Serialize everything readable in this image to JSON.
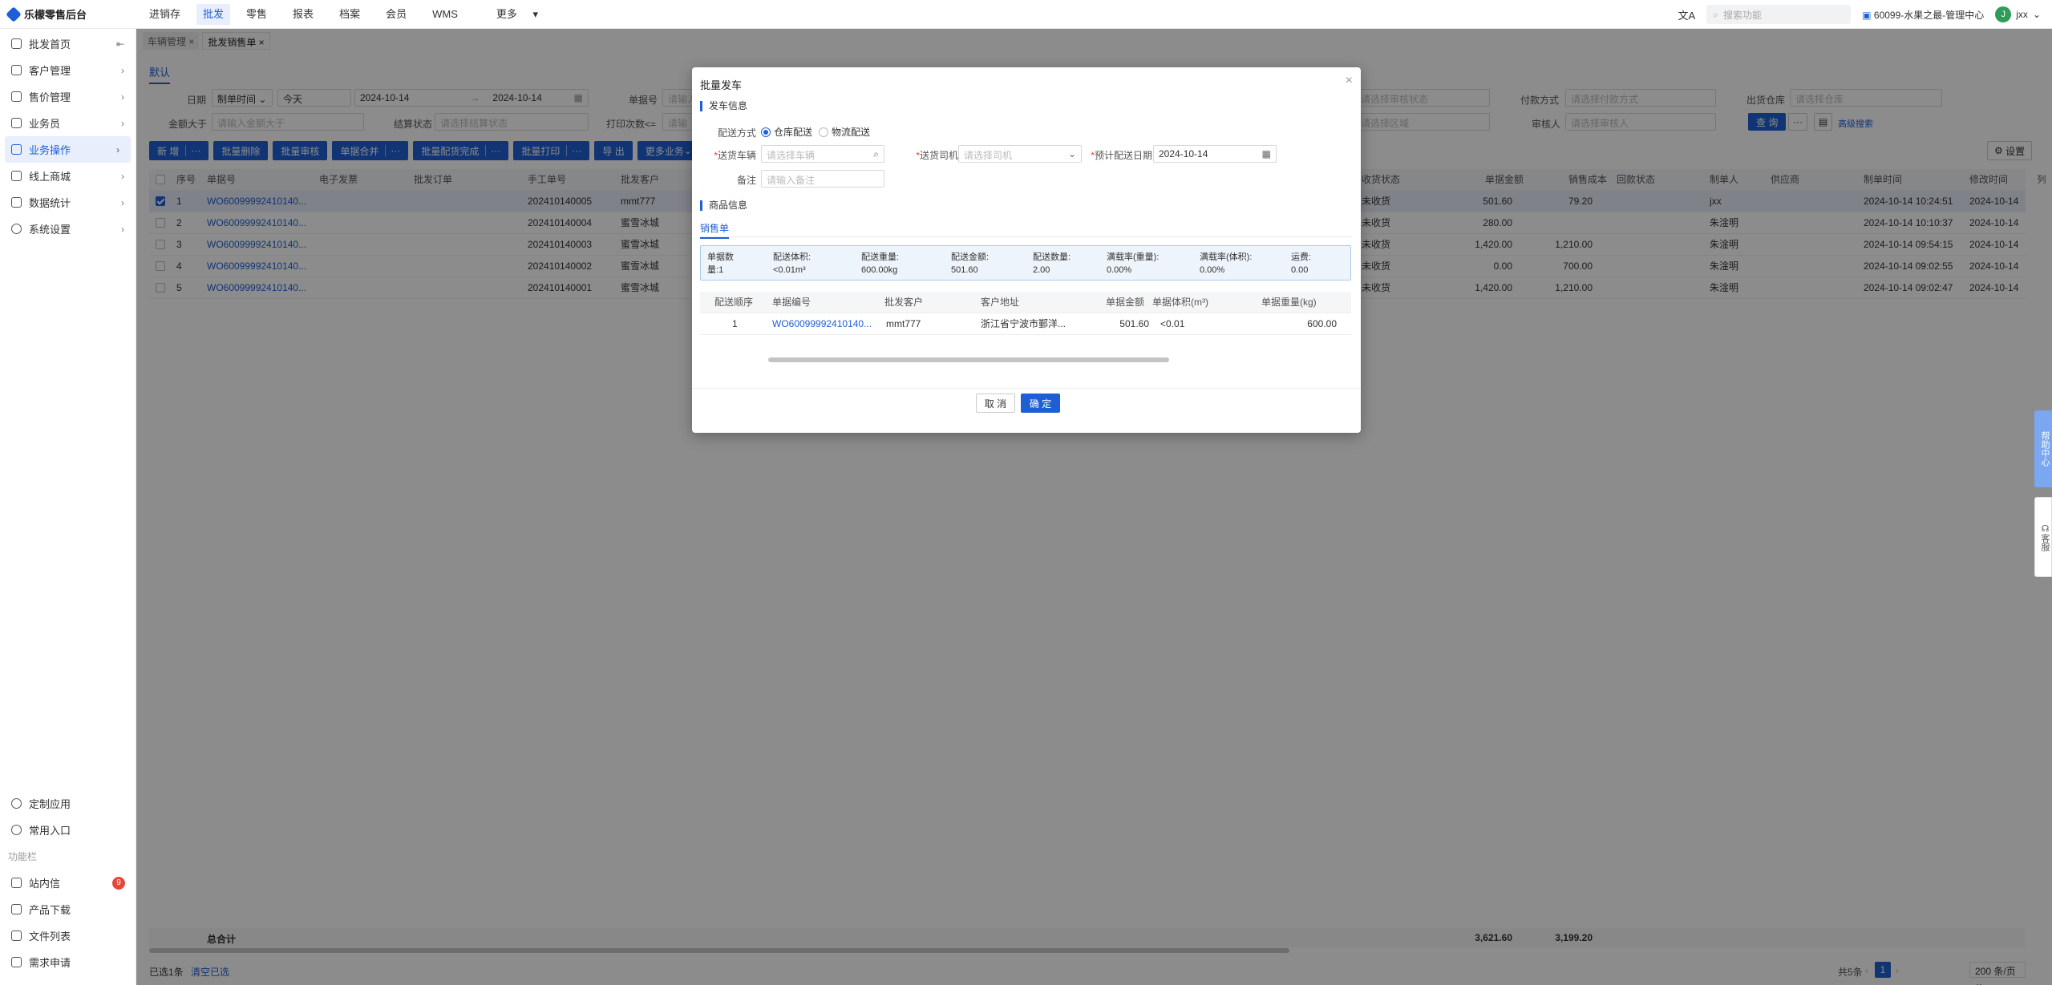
{
  "app": {
    "title": "乐檬零售后台"
  },
  "topnav": [
    "进销存",
    "批发",
    "零售",
    "报表",
    "档案",
    "会员",
    "WMS",
    "更多"
  ],
  "topnav_active": 1,
  "topright": {
    "search_placeholder": "搜索功能",
    "store": "60099-水果之最-管理中心",
    "user": "jxx",
    "avatar": "J"
  },
  "sidebar": {
    "items": [
      "批发首页",
      "客户管理",
      "售价管理",
      "业务员",
      "业务操作",
      "线上商城",
      "数据统计",
      "系统设置"
    ],
    "active": 4,
    "bottom_items": [
      "定制应用",
      "常用入口"
    ],
    "section": "功能栏",
    "tool_items": [
      "站内信",
      "产品下载",
      "文件列表",
      "需求申请"
    ],
    "badge": "9"
  },
  "tabs": [
    "车辆管理 ×",
    "批发销售单 ×"
  ],
  "default_tab": "默认",
  "filters": {
    "date_label": "日期",
    "date_type": "制单时间",
    "date_range": "今天",
    "date_start": "2024-10-14",
    "date_end": "2024-10-14",
    "date_sep": "→",
    "order_no_label": "单据号",
    "order_no_ph": "请输入",
    "amount_label": "金额大于",
    "amount_ph": "请输入金额大于",
    "settle_label": "结算状态",
    "settle_ph": "请选择结算状态",
    "print_label": "打印次数<=",
    "print_ph": "请输",
    "audit_state_ph": "请选择审核状态",
    "pay_label": "付款方式",
    "pay_ph": "请选择付款方式",
    "warehouse_label": "出货仓库",
    "warehouse_ph": "请选择仓库",
    "region_ph": "请选择区域",
    "auditor_label": "审核人",
    "auditor_ph": "请选择审核人",
    "query_btn": "查 询",
    "advanced": "高级搜索",
    "settings_btn": "设置"
  },
  "actions": [
    "新 增",
    "批量删除",
    "批量审核",
    "单据合并",
    "批量配货完成",
    "批量打印",
    "导 出",
    "更多业务"
  ],
  "table": {
    "headers": [
      "序号",
      "单据号",
      "电子发票",
      "批发订单",
      "手工单号",
      "批发客户",
      "收货状态",
      "单据金额",
      "销售成本",
      "回款状态",
      "制单人",
      "供应商",
      "制单时间",
      "修改时间"
    ],
    "rows": [
      {
        "no": "1",
        "order": "WO60099992410140...",
        "manual": "202410140005",
        "customer": "mmt777",
        "recv": "未收货",
        "amount": "501.60",
        "cost": "79.20",
        "maker": "jxx",
        "time": "2024-10-14 10:24:51",
        "mtime": "2024-10-14",
        "selected": true
      },
      {
        "no": "2",
        "order": "WO60099992410140...",
        "manual": "202410140004",
        "customer": "蜜雪冰城",
        "recv": "未收货",
        "amount": "280.00",
        "cost": "",
        "maker": "朱淦明",
        "time": "2024-10-14 10:10:37",
        "mtime": "2024-10-14",
        "selected": false
      },
      {
        "no": "3",
        "order": "WO60099992410140...",
        "manual": "202410140003",
        "customer": "蜜雪冰城",
        "recv": "未收货",
        "amount": "1,420.00",
        "cost": "1,210.00",
        "maker": "朱淦明",
        "time": "2024-10-14 09:54:15",
        "mtime": "2024-10-14",
        "selected": false
      },
      {
        "no": "4",
        "order": "WO60099992410140...",
        "manual": "202410140002",
        "customer": "蜜雪冰城",
        "recv": "未收货",
        "amount": "0.00",
        "cost": "700.00",
        "maker": "朱淦明",
        "time": "2024-10-14 09:02:55",
        "mtime": "2024-10-14",
        "selected": false
      },
      {
        "no": "5",
        "order": "WO60099992410140...",
        "manual": "202410140001",
        "customer": "蜜雪冰城",
        "recv": "未收货",
        "amount": "1,420.00",
        "cost": "1,210.00",
        "maker": "朱淦明",
        "time": "2024-10-14 09:02:47",
        "mtime": "2024-10-14",
        "selected": false
      }
    ],
    "total_label": "总合计",
    "total_amount": "3,621.60",
    "total_cost": "3,199.20",
    "selected_text": "已选1条",
    "clear_selected": "清空已选",
    "total_count": "共5条",
    "page": "1",
    "page_size": "200 条/页",
    "col_btn": "列"
  },
  "float": {
    "help": "帮助中心",
    "service": "客服"
  },
  "modal": {
    "title": "批量发车",
    "section1": "发车信息",
    "delivery_mode_label": "配送方式",
    "mode_options": [
      "仓库配送",
      "物流配送"
    ],
    "vehicle_label": "送货车辆",
    "vehicle_ph": "请选择车辆",
    "driver_label": "送货司机",
    "driver_ph": "请选择司机",
    "date_label": "预计配送日期",
    "date_value": "2024-10-14",
    "remark_label": "备注",
    "remark_ph": "请输入备注",
    "section2": "商品信息",
    "subtab": "销售单",
    "summary": [
      {
        "label": "单据数量:",
        "value": "1"
      },
      {
        "label": "配送体积:",
        "value": "<0.01m³"
      },
      {
        "label": "配送重量:",
        "value": "600.00kg"
      },
      {
        "label": "配送金额:",
        "value": "501.60"
      },
      {
        "label": "配送数量:",
        "value": "2.00"
      },
      {
        "label": "满载率(重量):",
        "value": "0.00%"
      },
      {
        "label": "满载率(体积):",
        "value": "0.00%"
      },
      {
        "label": "运费:",
        "value": "0.00"
      }
    ],
    "headers": [
      "配送顺序",
      "单据编号",
      "批发客户",
      "客户地址",
      "单据金额",
      "单据体积(m³)",
      "单据重量(kg)"
    ],
    "rows": [
      {
        "seq": "1",
        "order": "WO60099992410140...",
        "customer": "mmt777",
        "address": "浙江省宁波市鄞洋...",
        "amount": "501.60",
        "volume": "<0.01",
        "weight": "600.00"
      }
    ],
    "cancel": "取 消",
    "ok": "确 定"
  }
}
